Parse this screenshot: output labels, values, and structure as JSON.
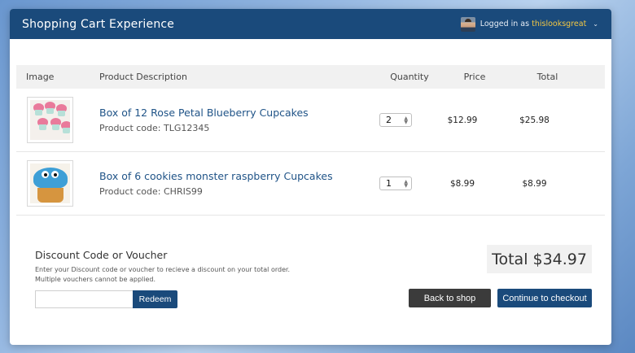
{
  "header": {
    "title": "Shopping Cart Experience",
    "logged_in_prefix": "Logged in as",
    "username": "thislooksgreat"
  },
  "table": {
    "columns": [
      "Image",
      "Product Description",
      "Quantity",
      "Price",
      "Total"
    ]
  },
  "items": [
    {
      "name": "Box of 12 Rose Petal Blueberry Cupcakes",
      "code": "Product code: TLG12345",
      "quantity": "2",
      "price": "$12.99",
      "total": "$25.98",
      "image_icon": "cupcakes-image"
    },
    {
      "name": "Box of 6 cookies monster raspberry Cupcakes",
      "code": "Product code: CHRIS99",
      "quantity": "1",
      "price": "$8.99",
      "total": "$8.99",
      "image_icon": "cookie-monster-cupcake-image"
    }
  ],
  "discount": {
    "title": "Discount Code or Voucher",
    "help_line1": "Enter your Discount code or voucher to recieve a discount on your total order.",
    "help_line2": "Multiple vouchers cannot be applied.",
    "input_value": "",
    "redeem_label": "Redeem"
  },
  "summary": {
    "total": "Total $34.97",
    "back_label": "Back to shop",
    "checkout_label": "Continue to checkout"
  },
  "colors": {
    "primary": "#1a4a7b",
    "accent_username": "#f2c744",
    "dark_button": "#3b3b3b"
  }
}
